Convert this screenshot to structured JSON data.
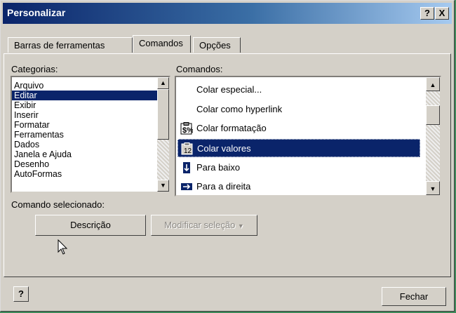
{
  "window": {
    "title": "Personalizar"
  },
  "titlebar_buttons": {
    "help": "?",
    "close": "X"
  },
  "tabs": [
    {
      "label": "Barras de ferramentas",
      "active": false
    },
    {
      "label": "Comandos",
      "active": true
    },
    {
      "label": "Opções",
      "active": false
    }
  ],
  "categories": {
    "label": "Categorias:",
    "items": [
      "Arquivo",
      "Editar",
      "Exibir",
      "Inserir",
      "Formatar",
      "Ferramentas",
      "Dados",
      "Janela e Ajuda",
      "Desenho",
      "AutoFormas"
    ],
    "selected": "Editar"
  },
  "commands": {
    "label": "Comandos:",
    "items": [
      {
        "label": "Colar especial...",
        "icon": "none"
      },
      {
        "label": "Colar como hyperlink",
        "icon": "none"
      },
      {
        "label": "Colar formatação",
        "icon": "paste-format-icon"
      },
      {
        "label": "Colar valores",
        "icon": "paste-values-icon",
        "selected": true
      },
      {
        "label": "Para baixo",
        "icon": "fill-down-icon"
      },
      {
        "label": "Para a direita",
        "icon": "fill-right-icon"
      }
    ]
  },
  "selected_command": {
    "label": "Comando selecionado:"
  },
  "buttons": {
    "description": "Descrição",
    "modify_selection": "Modificar seleção",
    "close": "Fechar",
    "help": "?"
  }
}
